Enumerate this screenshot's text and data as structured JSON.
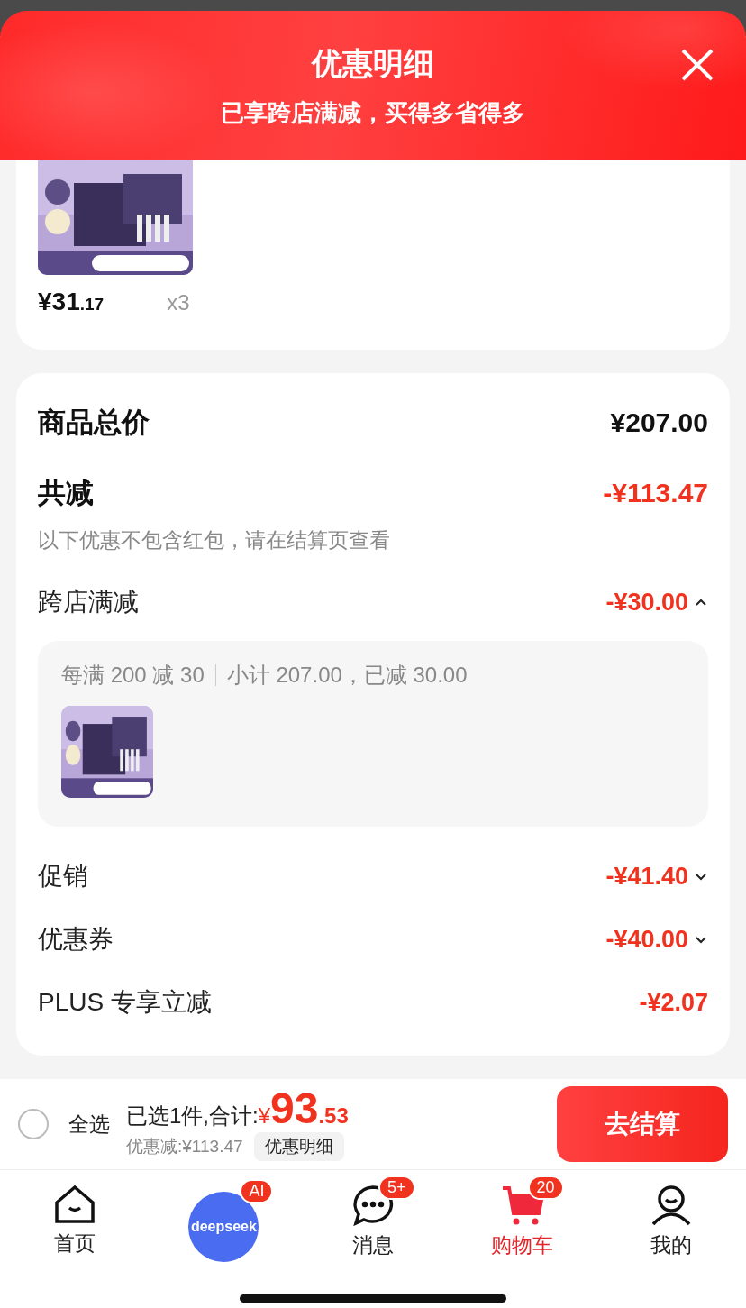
{
  "header": {
    "title": "优惠明细",
    "subtitle": "已享跨店满减，买得多省得多"
  },
  "product": {
    "price_main": "¥31",
    "price_decimal": ".17",
    "quantity": "x3"
  },
  "summary": {
    "total": {
      "label": "商品总价",
      "value": "¥207.00"
    },
    "discount": {
      "label": "共减",
      "value": "-¥113.47",
      "note": "以下优惠不包含红包，请在结算页查看"
    },
    "items": [
      {
        "kind": "expandable",
        "label": "跨店满减",
        "value": "-¥30.00",
        "expanded": true,
        "detail": {
          "rule": "每满 200 减 30",
          "subtotal": "小计 207.00，已减 30.00"
        }
      },
      {
        "kind": "expandable",
        "label": "促销",
        "value": "-¥41.40",
        "expanded": false
      },
      {
        "kind": "expandable",
        "label": "优惠券",
        "value": "-¥40.00",
        "expanded": false
      },
      {
        "kind": "plain",
        "label": "PLUS 专享立减",
        "value": "-¥2.07"
      }
    ]
  },
  "checkout_bar": {
    "select_all": {
      "label": "全选",
      "checked": false
    },
    "summary": "已选1件,合计:",
    "currency": "¥",
    "amount_main": "93",
    "amount_decimal": ".53",
    "saved": "优惠减:¥113.47",
    "detail_button": "优惠明细",
    "checkout_button": "去结算"
  },
  "tab_bar": [
    {
      "kind": "tab",
      "label": "首页",
      "selected": false
    },
    {
      "kind": "ai",
      "label": "deepseek",
      "badge": "AI"
    },
    {
      "kind": "tab",
      "label": "消息",
      "badge": "5+",
      "selected": false
    },
    {
      "kind": "tab",
      "label": "购物车",
      "badge": "20",
      "selected": true
    },
    {
      "kind": "tab",
      "label": "我的",
      "selected": false
    }
  ]
}
